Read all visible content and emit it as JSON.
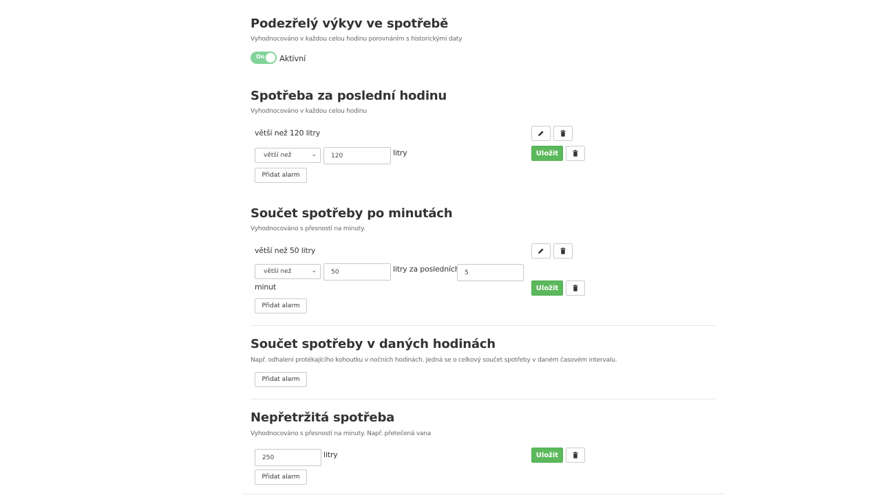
{
  "section1": {
    "title": "Podezřelý výkyv ve spotřebě",
    "description": "Vyhodnocováno v každou celou hodinu porovnáním s historickými daty",
    "toggle_state": "On",
    "toggle_label": "Aktivní"
  },
  "section2": {
    "title": "Spotřeba za poslední hodinu",
    "description": "Vyhodnocováno v každou celou hodinu",
    "rule_text": "větší než 120 litry",
    "operator": "větší než",
    "value": "120",
    "unit": "litry",
    "save_label": "Uložit",
    "add_label": "Přidat alarm"
  },
  "section3": {
    "title": "Součet spotřeby po minutách",
    "description": "Vyhodnocováno s přesností na minuty.",
    "rule_text": "větší než 50 litry",
    "operator": "větší než",
    "value": "50",
    "unit": "litry za posledních",
    "minutes": "5",
    "minutes_unit": "minut",
    "save_label": "Uložit",
    "add_label": "Přidat alarm"
  },
  "section4": {
    "title": "Součet spotřeby v daných hodinách",
    "description": "Např. odhalení protékajícího kohoutku v nočních hodinách. Jedná se o celkový součet spotřeby v daném časovém intervalu.",
    "add_label": "Přidat alarm"
  },
  "section5": {
    "title": "Nepřetržitá spotřeba",
    "description": "Vyhodnocováno s přesností na minuty. Např. přetečená vana",
    "value": "250",
    "unit": "litry",
    "save_label": "Uložit",
    "add_label": "Přidat alarm"
  },
  "icons": {
    "edit": "pencil-icon",
    "delete": "trash-icon",
    "dropdown": "chevron-down-icon"
  },
  "colors": {
    "toggle_on": "#82d39a",
    "save_button": "#5cb85c"
  }
}
